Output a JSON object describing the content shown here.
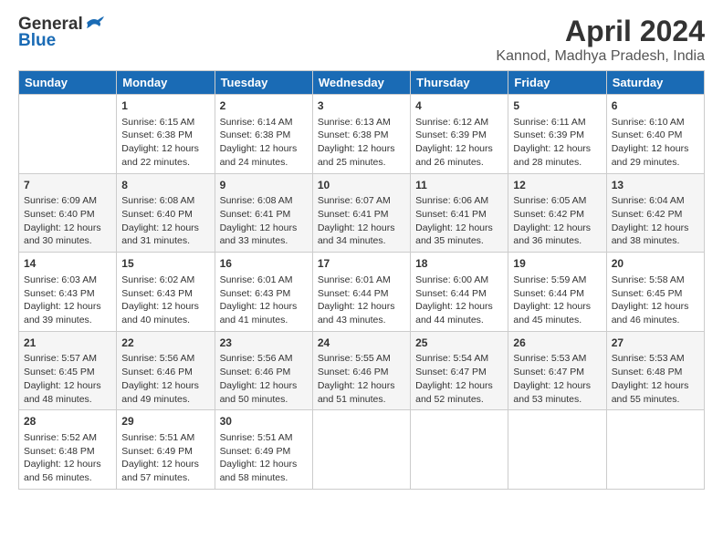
{
  "header": {
    "logo_general": "General",
    "logo_blue": "Blue",
    "title": "April 2024",
    "subtitle": "Kannod, Madhya Pradesh, India"
  },
  "days_of_week": [
    "Sunday",
    "Monday",
    "Tuesday",
    "Wednesday",
    "Thursday",
    "Friday",
    "Saturday"
  ],
  "weeks": [
    [
      {
        "day": "",
        "info": ""
      },
      {
        "day": "1",
        "info": "Sunrise: 6:15 AM\nSunset: 6:38 PM\nDaylight: 12 hours\nand 22 minutes."
      },
      {
        "day": "2",
        "info": "Sunrise: 6:14 AM\nSunset: 6:38 PM\nDaylight: 12 hours\nand 24 minutes."
      },
      {
        "day": "3",
        "info": "Sunrise: 6:13 AM\nSunset: 6:38 PM\nDaylight: 12 hours\nand 25 minutes."
      },
      {
        "day": "4",
        "info": "Sunrise: 6:12 AM\nSunset: 6:39 PM\nDaylight: 12 hours\nand 26 minutes."
      },
      {
        "day": "5",
        "info": "Sunrise: 6:11 AM\nSunset: 6:39 PM\nDaylight: 12 hours\nand 28 minutes."
      },
      {
        "day": "6",
        "info": "Sunrise: 6:10 AM\nSunset: 6:40 PM\nDaylight: 12 hours\nand 29 minutes."
      }
    ],
    [
      {
        "day": "7",
        "info": "Sunrise: 6:09 AM\nSunset: 6:40 PM\nDaylight: 12 hours\nand 30 minutes."
      },
      {
        "day": "8",
        "info": "Sunrise: 6:08 AM\nSunset: 6:40 PM\nDaylight: 12 hours\nand 31 minutes."
      },
      {
        "day": "9",
        "info": "Sunrise: 6:08 AM\nSunset: 6:41 PM\nDaylight: 12 hours\nand 33 minutes."
      },
      {
        "day": "10",
        "info": "Sunrise: 6:07 AM\nSunset: 6:41 PM\nDaylight: 12 hours\nand 34 minutes."
      },
      {
        "day": "11",
        "info": "Sunrise: 6:06 AM\nSunset: 6:41 PM\nDaylight: 12 hours\nand 35 minutes."
      },
      {
        "day": "12",
        "info": "Sunrise: 6:05 AM\nSunset: 6:42 PM\nDaylight: 12 hours\nand 36 minutes."
      },
      {
        "day": "13",
        "info": "Sunrise: 6:04 AM\nSunset: 6:42 PM\nDaylight: 12 hours\nand 38 minutes."
      }
    ],
    [
      {
        "day": "14",
        "info": "Sunrise: 6:03 AM\nSunset: 6:43 PM\nDaylight: 12 hours\nand 39 minutes."
      },
      {
        "day": "15",
        "info": "Sunrise: 6:02 AM\nSunset: 6:43 PM\nDaylight: 12 hours\nand 40 minutes."
      },
      {
        "day": "16",
        "info": "Sunrise: 6:01 AM\nSunset: 6:43 PM\nDaylight: 12 hours\nand 41 minutes."
      },
      {
        "day": "17",
        "info": "Sunrise: 6:01 AM\nSunset: 6:44 PM\nDaylight: 12 hours\nand 43 minutes."
      },
      {
        "day": "18",
        "info": "Sunrise: 6:00 AM\nSunset: 6:44 PM\nDaylight: 12 hours\nand 44 minutes."
      },
      {
        "day": "19",
        "info": "Sunrise: 5:59 AM\nSunset: 6:44 PM\nDaylight: 12 hours\nand 45 minutes."
      },
      {
        "day": "20",
        "info": "Sunrise: 5:58 AM\nSunset: 6:45 PM\nDaylight: 12 hours\nand 46 minutes."
      }
    ],
    [
      {
        "day": "21",
        "info": "Sunrise: 5:57 AM\nSunset: 6:45 PM\nDaylight: 12 hours\nand 48 minutes."
      },
      {
        "day": "22",
        "info": "Sunrise: 5:56 AM\nSunset: 6:46 PM\nDaylight: 12 hours\nand 49 minutes."
      },
      {
        "day": "23",
        "info": "Sunrise: 5:56 AM\nSunset: 6:46 PM\nDaylight: 12 hours\nand 50 minutes."
      },
      {
        "day": "24",
        "info": "Sunrise: 5:55 AM\nSunset: 6:46 PM\nDaylight: 12 hours\nand 51 minutes."
      },
      {
        "day": "25",
        "info": "Sunrise: 5:54 AM\nSunset: 6:47 PM\nDaylight: 12 hours\nand 52 minutes."
      },
      {
        "day": "26",
        "info": "Sunrise: 5:53 AM\nSunset: 6:47 PM\nDaylight: 12 hours\nand 53 minutes."
      },
      {
        "day": "27",
        "info": "Sunrise: 5:53 AM\nSunset: 6:48 PM\nDaylight: 12 hours\nand 55 minutes."
      }
    ],
    [
      {
        "day": "28",
        "info": "Sunrise: 5:52 AM\nSunset: 6:48 PM\nDaylight: 12 hours\nand 56 minutes."
      },
      {
        "day": "29",
        "info": "Sunrise: 5:51 AM\nSunset: 6:49 PM\nDaylight: 12 hours\nand 57 minutes."
      },
      {
        "day": "30",
        "info": "Sunrise: 5:51 AM\nSunset: 6:49 PM\nDaylight: 12 hours\nand 58 minutes."
      },
      {
        "day": "",
        "info": ""
      },
      {
        "day": "",
        "info": ""
      },
      {
        "day": "",
        "info": ""
      },
      {
        "day": "",
        "info": ""
      }
    ]
  ]
}
